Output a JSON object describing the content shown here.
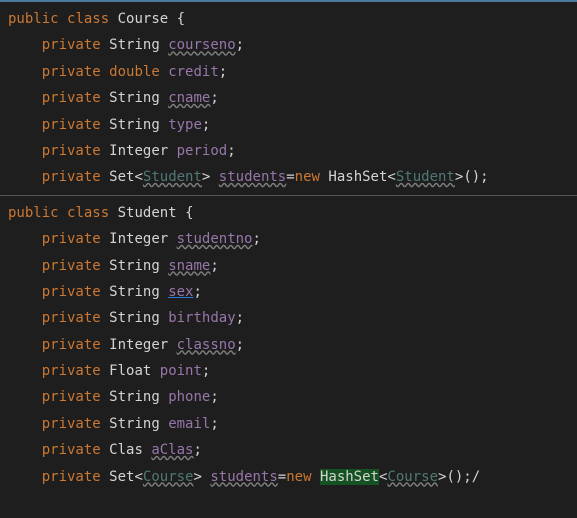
{
  "panels": [
    {
      "declaration": {
        "pub": "public",
        "cls": "class",
        "name": "Course",
        "brace": "{"
      },
      "fields": [
        {
          "kw": "private",
          "type": "String",
          "name": "courseno",
          "wavy": true
        },
        {
          "kw": "private",
          "type": "double",
          "name": "credit"
        },
        {
          "kw": "private",
          "type": "String",
          "name": "cname",
          "wavy": true
        },
        {
          "kw": "private",
          "type": "String",
          "name": "type"
        },
        {
          "kw": "private",
          "type": "Integer",
          "name": "period"
        }
      ],
      "setline": {
        "kw": "private",
        "settype": "Set",
        "gentype": "Student",
        "name": "students",
        "newkw": "new",
        "impl": "HashSet",
        "implgen": "Student",
        "tail": "();"
      }
    },
    {
      "declaration": {
        "pub": "public",
        "cls": "class",
        "name": "Student",
        "brace": "{"
      },
      "fields": [
        {
          "kw": "private",
          "type": "Integer",
          "name": "studentno",
          "wavy": true
        },
        {
          "kw": "private",
          "type": "String",
          "name": "sname",
          "wavy": true
        },
        {
          "kw": "private",
          "type": "String",
          "name": "sex",
          "link": true
        },
        {
          "kw": "private",
          "type": "String",
          "name": "birthday"
        },
        {
          "kw": "private",
          "type": "Integer",
          "name": "classno",
          "wavy": true
        },
        {
          "kw": "private",
          "type": "Float",
          "name": "point"
        },
        {
          "kw": "private",
          "type": "String",
          "name": "phone"
        },
        {
          "kw": "private",
          "type": "String",
          "name": "email"
        },
        {
          "kw": "private",
          "type": "Clas",
          "name": "aClas",
          "wavy": true
        }
      ],
      "setline": {
        "kw": "private",
        "settype": "Set",
        "gentype": "Course",
        "name": "students",
        "newkw": "new",
        "impl": "HashSet",
        "implgen": "Course",
        "tail": "();/",
        "highlight_impl": true
      }
    }
  ]
}
